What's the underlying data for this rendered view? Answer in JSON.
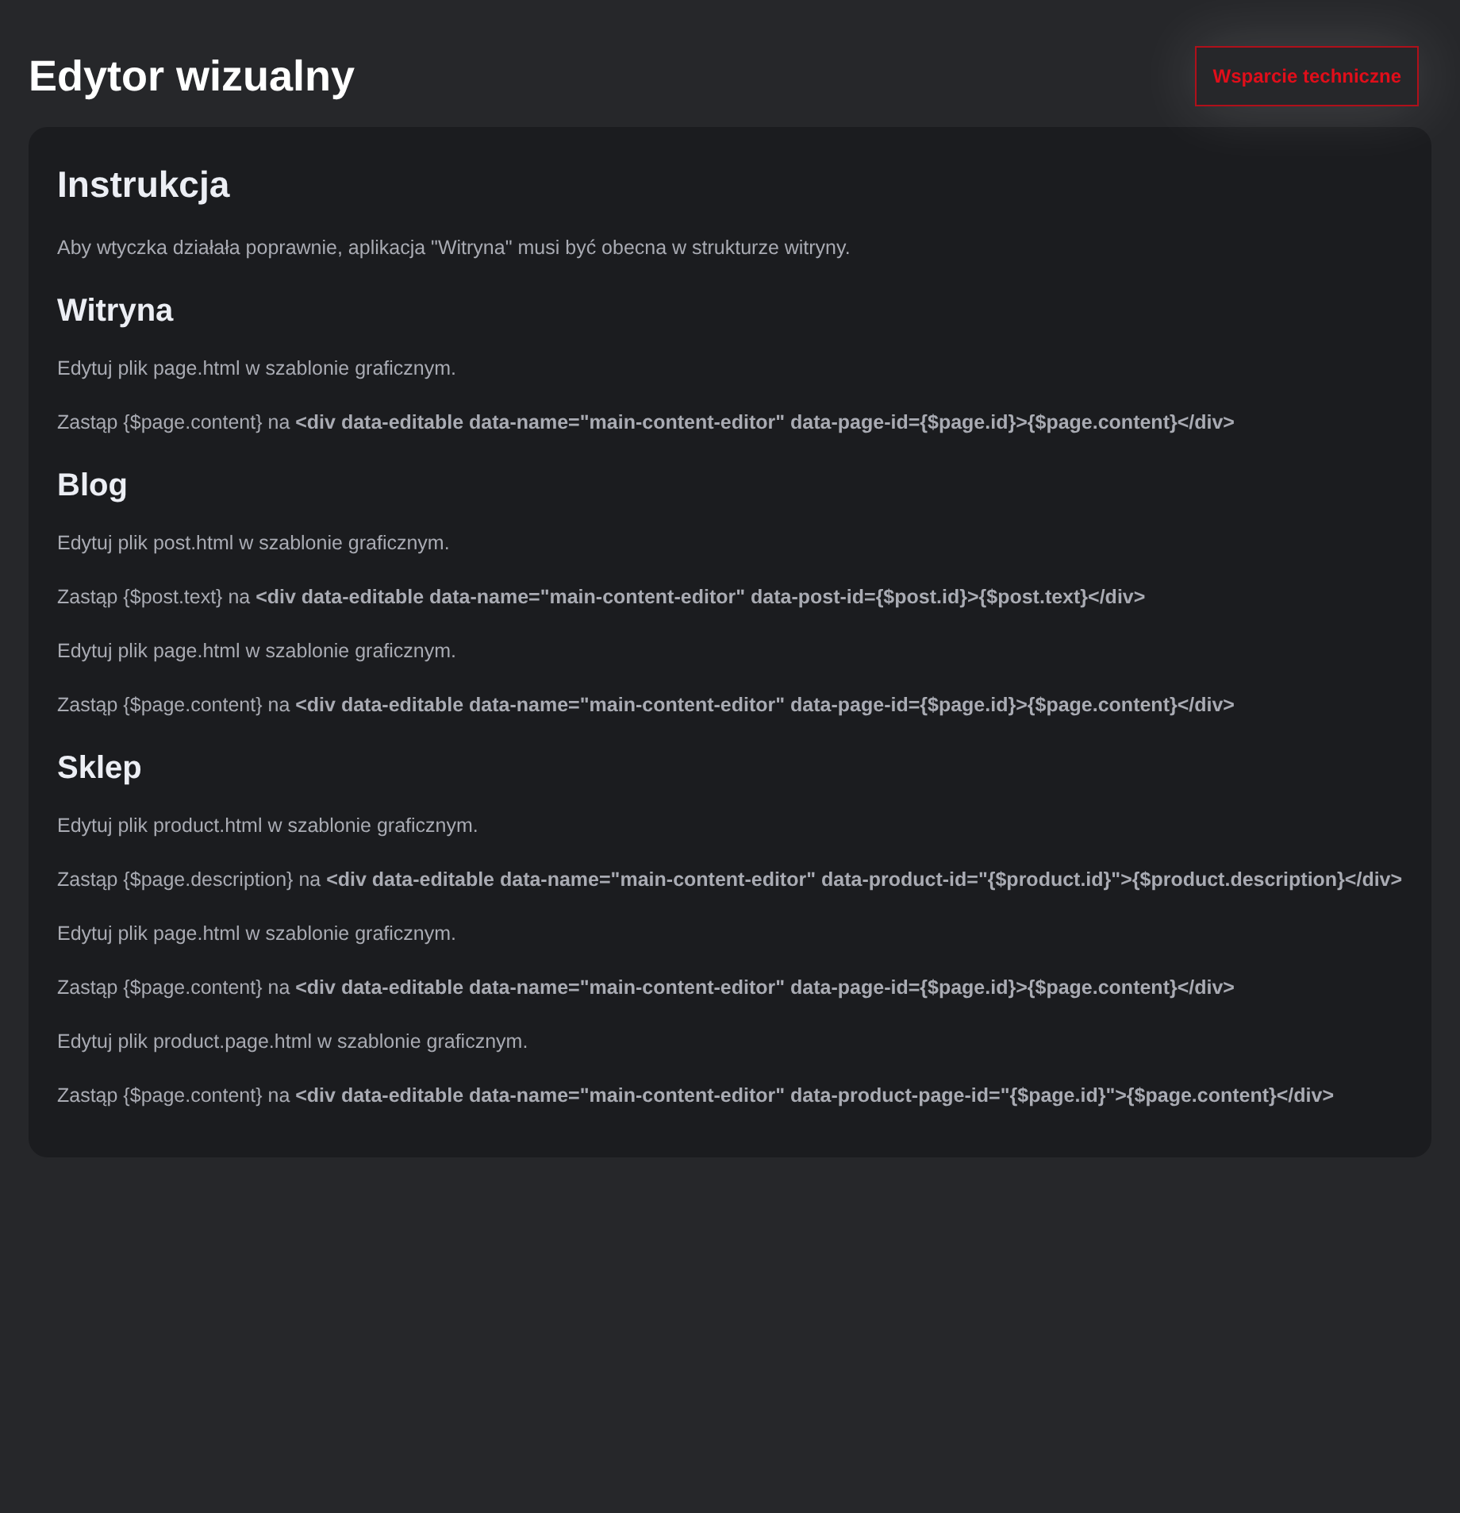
{
  "header": {
    "title": "Edytor wizualny",
    "support_button": "Wsparcie techniczne"
  },
  "sections": [
    {
      "heading": "Instrukcja",
      "paragraphs": [
        "Aby wtyczka działała poprawnie, aplikacja \"Witryna\" musi być obecna w strukturze witryny."
      ]
    },
    {
      "heading": "Witryna",
      "paragraphs": [
        "Edytuj plik page.html w szablonie graficznym.",
        "Zastąp {$page.content} na **<div data-editable data-name=\"main-content-editor\" data-page-id={$page.id}>{$page.content}</div>**"
      ]
    },
    {
      "heading": "Blog",
      "paragraphs": [
        "Edytuj plik post.html w szablonie graficznym.",
        "Zastąp {$post.text} na **<div data-editable data-name=\"main-content-editor\" data-post-id={$post.id}>{$post.text}</div>**",
        "Edytuj plik page.html w szablonie graficznym.",
        "Zastąp {$page.content} na **<div data-editable data-name=\"main-content-editor\" data-page-id={$page.id}>{$page.content}</div>**"
      ]
    },
    {
      "heading": "Sklep",
      "paragraphs": [
        "Edytuj plik product.html w szablonie graficznym.",
        "Zastąp {$page.description} na **<div data-editable data-name=\"main-content-editor\" data-product-id=\"{$product.id}\">{$product.description}</div>**",
        "Edytuj plik page.html w szablonie graficznym.",
        "Zastąp {$page.content} na **<div data-editable data-name=\"main-content-editor\" data-page-id={$page.id}>{$page.content}</div>**",
        "Edytuj plik product.page.html w szablonie graficznym.",
        "Zastąp {$page.content} na **<div data-editable data-name=\"main-content-editor\" data-product-page-id=\"{$page.id}\">{$page.content}</div>**"
      ]
    }
  ]
}
